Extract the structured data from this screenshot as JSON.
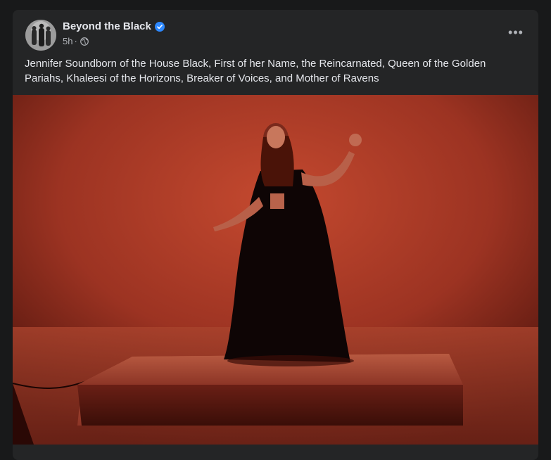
{
  "post": {
    "author": "Beyond the Black",
    "verified": true,
    "time": "5h",
    "separator": "·",
    "audience_icon": "globe-icon",
    "more_icon": "ellipsis-icon",
    "more_label": "•••",
    "caption": "Jennifer Soundborn of the House Black, First of her Name, the Reincarnated, Queen of the Golden Pariahs, Khaleesi of the Horizons, Breaker of Voices, and Mother of Ravens",
    "image": {
      "description": "woman in long black cape standing on a low platform against a red studio backdrop"
    }
  },
  "colors": {
    "background": "#18191a",
    "card": "#242526",
    "primary_text": "#e4e6eb",
    "secondary_text": "#b0b3b8",
    "verified": "#2d88ff",
    "backdrop": "#b5412c"
  }
}
